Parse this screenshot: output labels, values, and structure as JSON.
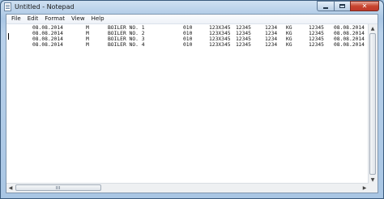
{
  "window": {
    "title": "Untitled - Notepad"
  },
  "caption": {
    "minimize": "–",
    "maximize": "□",
    "close": "✕"
  },
  "menu": [
    "File",
    "Edit",
    "Format",
    "View",
    "Help"
  ],
  "rows": [
    [
      "08.08.2014",
      "M",
      "BOILER NO. 1",
      "010",
      "123X345",
      "12345",
      "1234",
      "KG",
      "12345",
      "08.08.2014"
    ],
    [
      "08.08.2014",
      "M",
      "BOILER NO. 2",
      "010",
      "123X345",
      "12345",
      "1234",
      "KG",
      "12345",
      "08.08.2014"
    ],
    [
      "08.08.2014",
      "M",
      "BOILER NO. 3",
      "010",
      "123X345",
      "12345",
      "1234",
      "KG",
      "12345",
      "08.08.2014"
    ],
    [
      "08.08.2014",
      "M",
      "BOILER NO. 4",
      "010",
      "123X345",
      "12345",
      "1234",
      "KG",
      "12345",
      "08.08.2014"
    ]
  ]
}
